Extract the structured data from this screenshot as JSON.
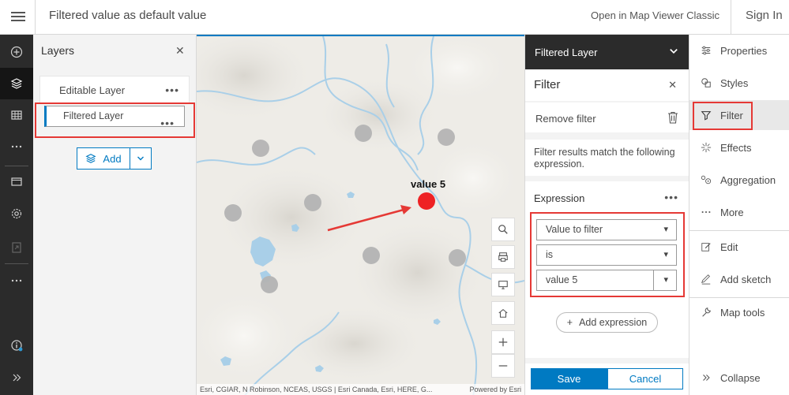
{
  "header": {
    "title": "Filtered value as default value",
    "open_classic": "Open in Map Viewer Classic",
    "sign_in": "Sign In"
  },
  "left_toolbar": {
    "items": [
      "plus-icon",
      "layers-icon",
      "table-icon",
      "more-icon",
      "folder-icon",
      "settings-icon",
      "export-icon",
      "more-icon-2",
      "info-icon",
      "expand-icon"
    ],
    "active": "layers-icon"
  },
  "layers_panel": {
    "title": "Layers",
    "layers": [
      {
        "name": "Editable Layer",
        "selected": false
      },
      {
        "name": "Filtered Layer",
        "selected": true
      }
    ],
    "add_label": "Add"
  },
  "map": {
    "feature_label": "value 5",
    "attribution": "Esri, CGIAR, N Robinson, NCEAS, USGS | Esri Canada, Esri, HERE, G...",
    "powered_by": "Powered by Esri",
    "controls": [
      "search-icon",
      "print-icon",
      "screen-icon",
      "home-icon",
      "zoom-in-icon",
      "zoom-out-icon"
    ]
  },
  "filter_panel": {
    "layer_title": "Filtered Layer",
    "title": "Filter",
    "remove_filter": "Remove filter",
    "description": "Filter results match the following expression.",
    "expression_label": "Expression",
    "field_value": "Value to filter",
    "operator_value": "is",
    "value_value": "value 5",
    "add_expression": "Add expression",
    "save": "Save",
    "cancel": "Cancel"
  },
  "right_toolbar": {
    "items": [
      {
        "label": "Properties",
        "icon": "sliders-icon"
      },
      {
        "label": "Styles",
        "icon": "styles-icon"
      },
      {
        "label": "Filter",
        "icon": "filter-icon",
        "active": true
      },
      {
        "label": "Effects",
        "icon": "sparkle-icon"
      },
      {
        "label": "Aggregation",
        "icon": "aggregation-icon"
      },
      {
        "label": "More",
        "icon": "more-icon"
      },
      {
        "label": "Edit",
        "icon": "edit-icon"
      },
      {
        "label": "Add sketch",
        "icon": "sketch-icon"
      },
      {
        "label": "Map tools",
        "icon": "wrench-icon"
      },
      {
        "label": "Collapse",
        "icon": "collapse-icon"
      }
    ]
  },
  "colors": {
    "accent": "#007ac2",
    "highlight": "#e53935",
    "feature_selected": "#ee2224",
    "feature": "#b4b4b4"
  }
}
